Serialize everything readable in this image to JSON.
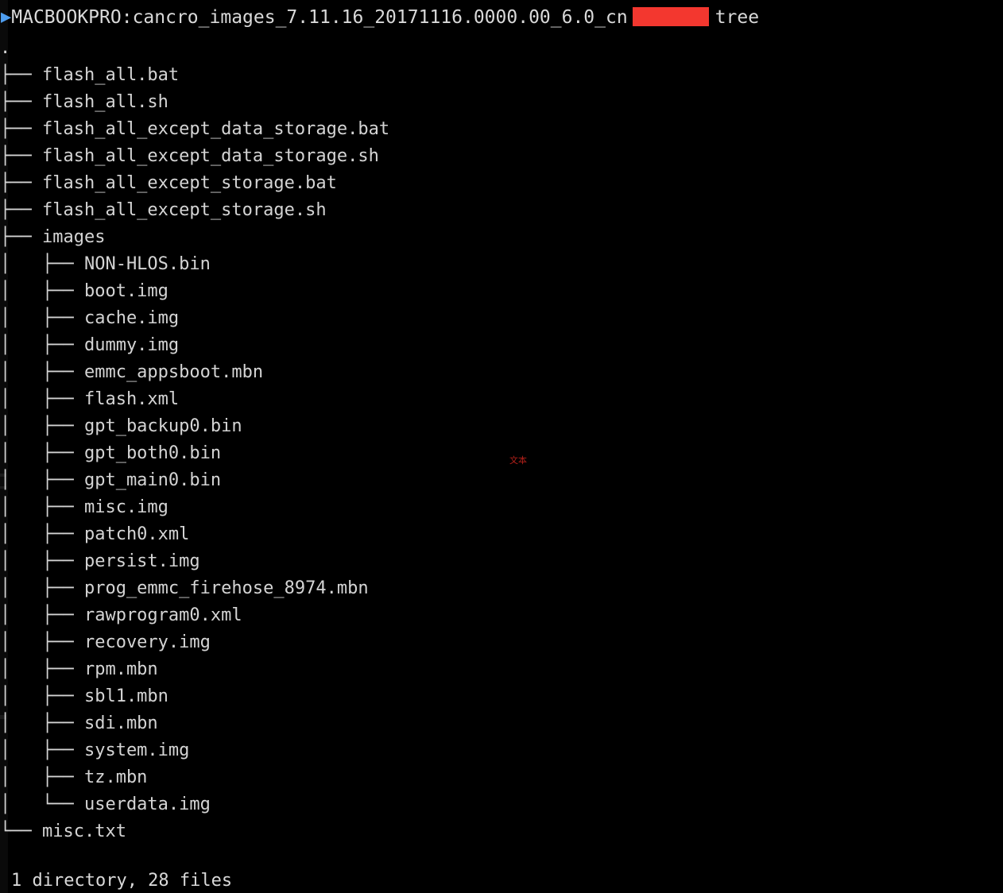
{
  "terminal": {
    "background_color": "#000000",
    "foreground_color": "#d4d4d4",
    "prompt_marker_color": "#4f9ef0",
    "redaction_color": "#f3372f",
    "prompt": {
      "marker": "▶",
      "host_and_path": "MACBOOKPRO:cancro_images_7.11.16_20171116.0000.00_6.0_cn",
      "redacted_user": "",
      "command": "tree"
    },
    "output": {
      "root": ".",
      "lines": [
        {
          "indent": 0,
          "connector": "├── ",
          "name": "flash_all.bat"
        },
        {
          "indent": 0,
          "connector": "├── ",
          "name": "flash_all.sh"
        },
        {
          "indent": 0,
          "connector": "├── ",
          "name": "flash_all_except_data_storage.bat"
        },
        {
          "indent": 0,
          "connector": "├── ",
          "name": "flash_all_except_data_storage.sh"
        },
        {
          "indent": 0,
          "connector": "├── ",
          "name": "flash_all_except_storage.bat"
        },
        {
          "indent": 0,
          "connector": "├── ",
          "name": "flash_all_except_storage.sh"
        },
        {
          "indent": 0,
          "connector": "├── ",
          "name": "images"
        },
        {
          "indent": 1,
          "connector": "├── ",
          "name": "NON-HLOS.bin"
        },
        {
          "indent": 1,
          "connector": "├── ",
          "name": "boot.img"
        },
        {
          "indent": 1,
          "connector": "├── ",
          "name": "cache.img"
        },
        {
          "indent": 1,
          "connector": "├── ",
          "name": "dummy.img"
        },
        {
          "indent": 1,
          "connector": "├── ",
          "name": "emmc_appsboot.mbn"
        },
        {
          "indent": 1,
          "connector": "├── ",
          "name": "flash.xml"
        },
        {
          "indent": 1,
          "connector": "├── ",
          "name": "gpt_backup0.bin"
        },
        {
          "indent": 1,
          "connector": "├── ",
          "name": "gpt_both0.bin"
        },
        {
          "indent": 1,
          "connector": "├── ",
          "name": "gpt_main0.bin"
        },
        {
          "indent": 1,
          "connector": "├── ",
          "name": "misc.img"
        },
        {
          "indent": 1,
          "connector": "├── ",
          "name": "patch0.xml"
        },
        {
          "indent": 1,
          "connector": "├── ",
          "name": "persist.img"
        },
        {
          "indent": 1,
          "connector": "├── ",
          "name": "prog_emmc_firehose_8974.mbn"
        },
        {
          "indent": 1,
          "connector": "├── ",
          "name": "rawprogram0.xml"
        },
        {
          "indent": 1,
          "connector": "├── ",
          "name": "recovery.img"
        },
        {
          "indent": 1,
          "connector": "├── ",
          "name": "rpm.mbn"
        },
        {
          "indent": 1,
          "connector": "├── ",
          "name": "sbl1.mbn"
        },
        {
          "indent": 1,
          "connector": "├── ",
          "name": "sdi.mbn"
        },
        {
          "indent": 1,
          "connector": "├── ",
          "name": "system.img"
        },
        {
          "indent": 1,
          "connector": "├── ",
          "name": "tz.mbn"
        },
        {
          "indent": 1,
          "connector": "└── ",
          "name": "userdata.img"
        },
        {
          "indent": 0,
          "connector": "└── ",
          "name": "misc.txt"
        }
      ],
      "summary": "1 directory, 28 files"
    },
    "artifact_text": "文本"
  }
}
